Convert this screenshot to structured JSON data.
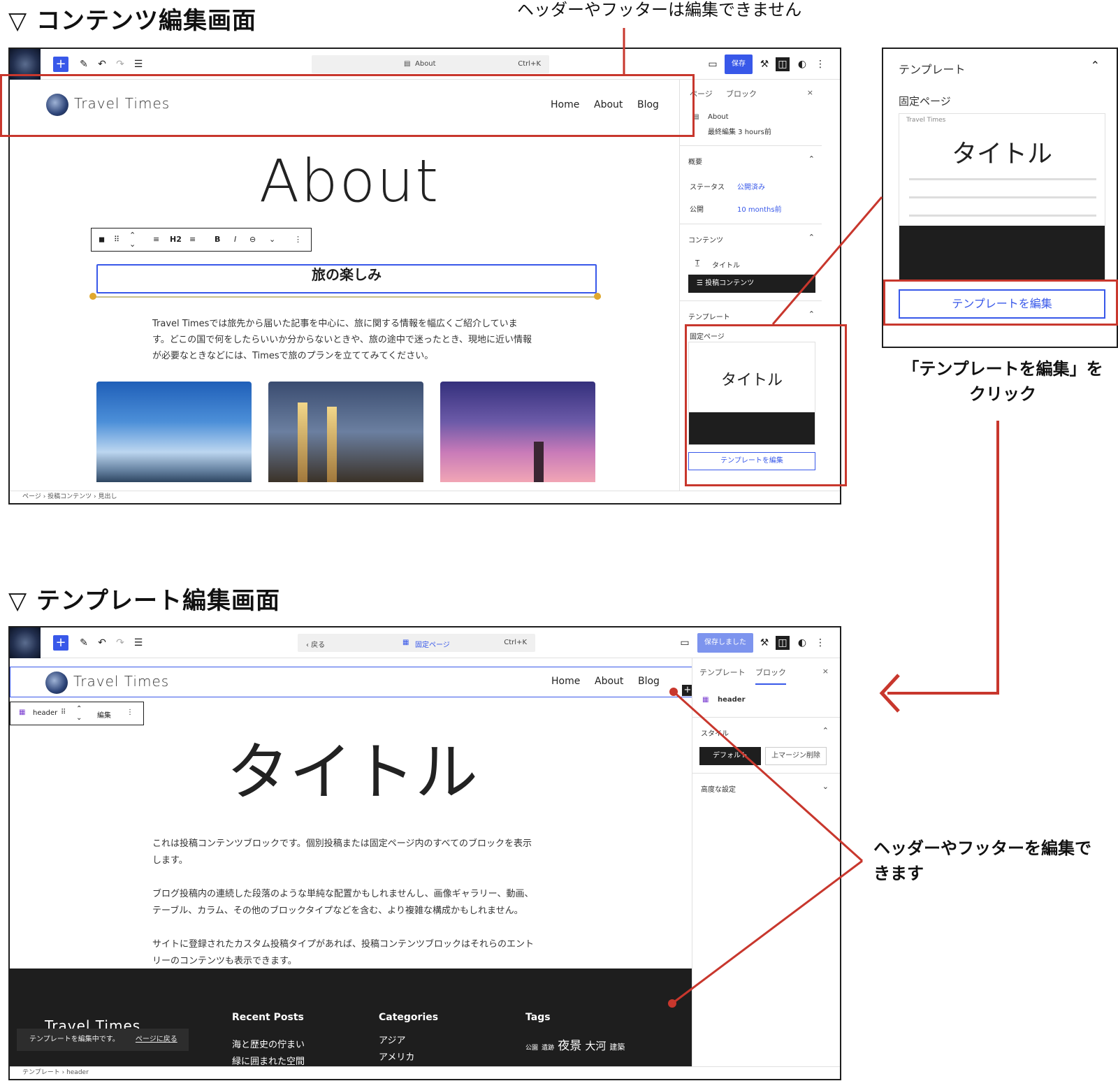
{
  "section1": {
    "title": "▽ コンテンツ編集画面",
    "callout_header": "ヘッダーやフッターは編集できません"
  },
  "section2": {
    "title": "▽ テンプレート編集画面",
    "callout_footer_line1": "ヘッダーやフッターを編集で",
    "callout_footer_line2": "きます"
  },
  "zoom_callout": {
    "line1": "「テンプレートを編集」を",
    "line2": "クリック",
    "panel_header": "テンプレート",
    "panel_sub": "固定ページ",
    "mini_title": "タイトル",
    "button": "テンプレートを編集",
    "mini_brand": "Travel Times"
  },
  "editor1": {
    "toolbar": {
      "plus": "+",
      "doc_title": "About",
      "shortcut": "Ctrl+K",
      "save": "保存"
    },
    "site": {
      "brand": "Travel Times",
      "nav": [
        "Home",
        "About",
        "Blog"
      ]
    },
    "page_title": "About",
    "block_toolbar": {
      "h2": "H2",
      "bold": "B",
      "italic": "I"
    },
    "heading": "旅の楽しみ",
    "paragraph_lines": [
      "Travel Timesでは旅先から届いた記事を中心に、旅に関する情報を幅広くご紹介していま",
      "す。どこの国で何をしたらいいか分からないときや、旅の途中で迷ったとき、現地に近い情報",
      "が必要なときなどには、Timesで旅のプランを立ててみてください。"
    ],
    "breadcrumb": [
      "ページ",
      "投稿コンテンツ",
      "見出し"
    ],
    "sidebar": {
      "tab_page": "ページ",
      "tab_block": "ブロック",
      "close": "×",
      "doc_name": "About",
      "doc_meta": "最終編集 3 hours前",
      "summary": "概要",
      "status_label": "ステータス",
      "status_value": "公開済み",
      "publish_label": "公開",
      "publish_value": "10 months前",
      "content": "コンテンツ",
      "content_title": "タイトル",
      "content_post": "投稿コンテンツ",
      "template": "テンプレート",
      "template_sub": "固定ページ",
      "mini_title": "タイトル",
      "edit_template": "テンプレートを編集"
    }
  },
  "editor2": {
    "toolbar": {
      "back": "‹ 戻る",
      "template_name": "固定ページ",
      "shortcut": "Ctrl+K",
      "saved": "保存しました"
    },
    "site": {
      "brand": "Travel Times",
      "nav": [
        "Home",
        "About",
        "Blog"
      ]
    },
    "header_block": {
      "label": "header",
      "edit": "編集"
    },
    "page_title": "タイトル",
    "paragraphs": [
      "これは投稿コンテンツブロックです。個別投稿または固定ページ内のすべてのブロックを表示",
      "します。",
      "ブログ投稿内の連続した段落のような単純な配置かもしれませんし、画像ギャラリー、動画、",
      "テーブル、カラム、その他のブロックタイプなどを含む、より複雑な構成かもしれません。",
      "サイトに登録されたカスタム投稿タイプがあれば、投稿コンテンツブロックはそれらのエント",
      "リーのコンテンツも表示できます。"
    ],
    "footer": {
      "brand": "Travel Times",
      "recent_title": "Recent Posts",
      "recent": [
        "海と歴史の佇まい",
        "緑に囲まれた空間"
      ],
      "cat_title": "Categories",
      "cats": [
        "アジア",
        "アメリカ"
      ],
      "tag_title": "Tags",
      "tags": [
        "公園",
        "遺跡",
        "夜景",
        "大河",
        "建築"
      ]
    },
    "notice": {
      "text": "テンプレートを編集中です。",
      "link": "ページに戻る"
    },
    "breadcrumb": [
      "テンプレート",
      "header"
    ],
    "sidebar": {
      "tab_template": "テンプレート",
      "tab_block": "ブロック",
      "close": "×",
      "block_name": "header",
      "style": "スタイル",
      "style_default": "デフォルト",
      "style_remove": "上マージン削除",
      "advanced": "高度な設定"
    }
  },
  "colors": {
    "accent": "#3858e9",
    "annotation_red": "#c8372d",
    "footer_bg": "#1e1e1e"
  }
}
